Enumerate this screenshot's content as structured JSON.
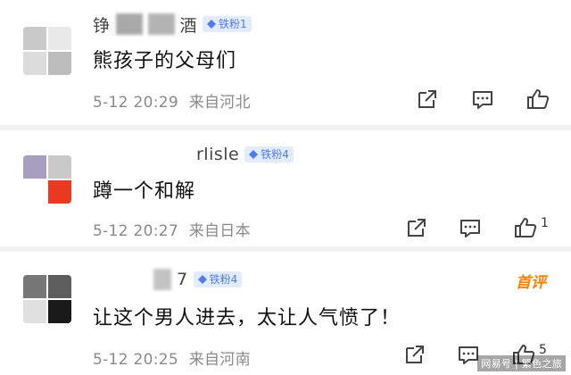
{
  "comments": [
    {
      "username_prefix": "铮",
      "username_suffix": "酒",
      "fan_badge": "铁粉1",
      "text": "熊孩子的父母们",
      "time": "5-12 20:29",
      "location": "来自河北",
      "avatar_colors": [
        "#c9c9c9",
        "#e8e8e8",
        "#dcdcdc",
        "#bcbcbc"
      ]
    },
    {
      "username_prefix": "",
      "username_suffix": "rlisle",
      "fan_badge": "铁粉4",
      "text": "蹲一个和解",
      "time": "5-12 20:27",
      "location": "来自日本",
      "avatar_colors": [
        "#a79ec0",
        "#c9c9c9",
        "#ffffff",
        "#ea3b22"
      ]
    },
    {
      "username_prefix": "",
      "username_suffix": "7",
      "fan_badge": "铁粉4",
      "text": "让这个男人进去，太让人气愤了！",
      "time": "5-12 20:25",
      "location": "来自河南",
      "hot_tag": "首评",
      "avatar_colors": [
        "#777777",
        "#5d5d5d",
        "#e0e0e0",
        "#1a1a1a"
      ]
    }
  ],
  "icons": {
    "share": "share-icon",
    "comment": "comment-icon",
    "like": "like-icon"
  },
  "like_counts": [
    "",
    "1",
    "5"
  ],
  "watermark": "网易号 | 繁色之旅",
  "colors": {
    "badge_bg": "#e3ecff",
    "badge_text": "#4d7cf2",
    "hot_tag": "#ff8200",
    "meta_text": "#8a8a8a"
  }
}
